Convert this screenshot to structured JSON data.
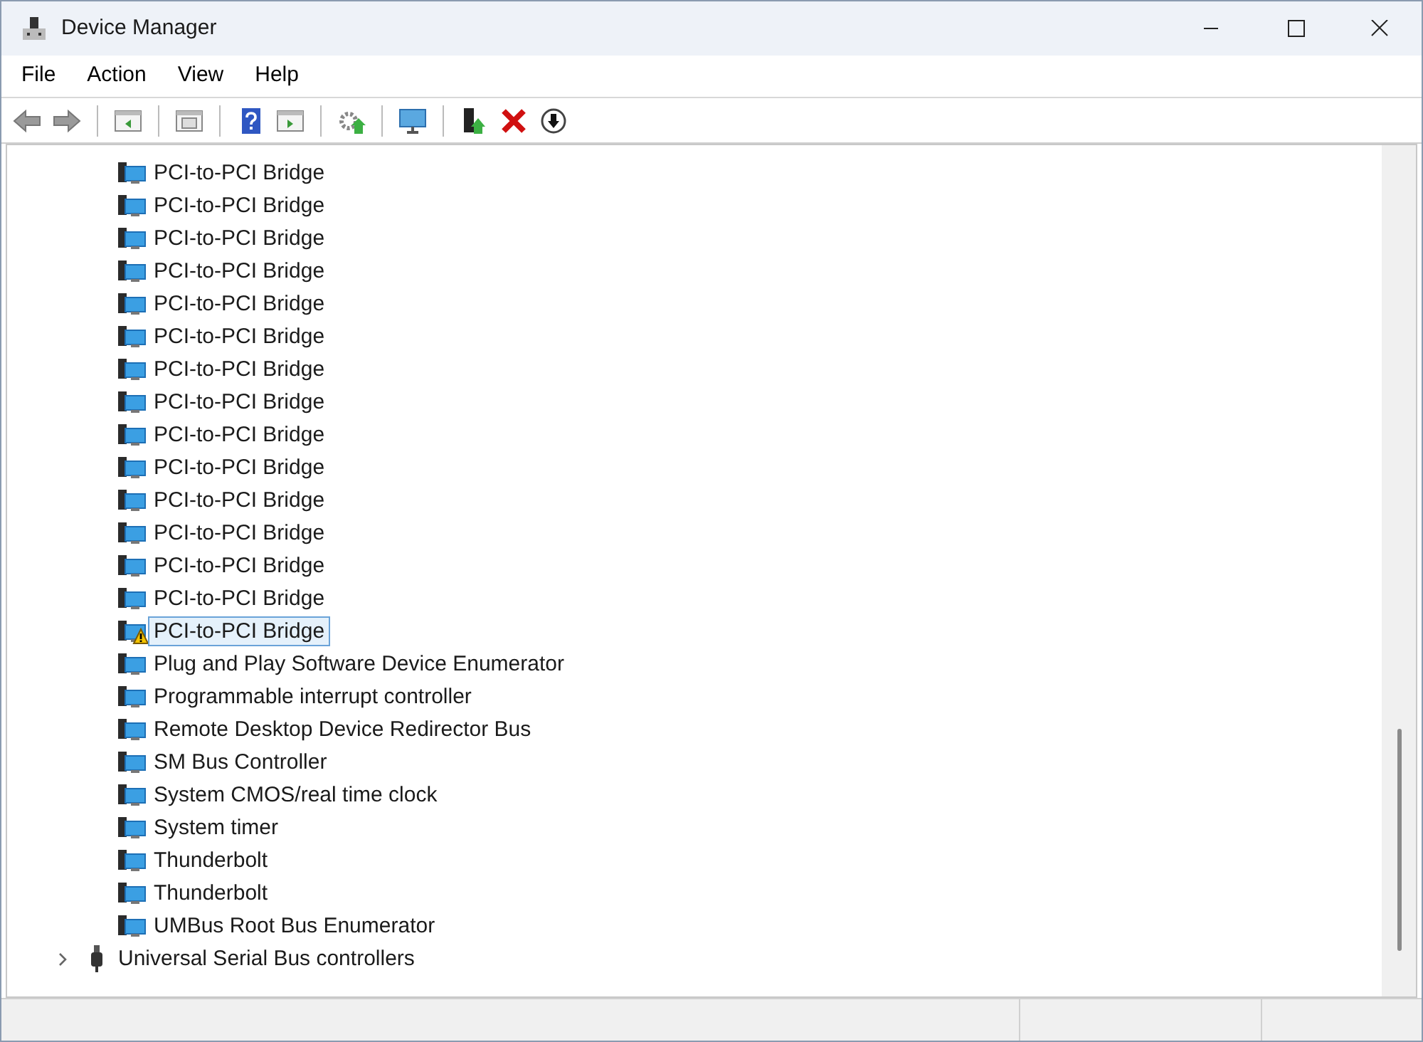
{
  "window": {
    "title": "Device Manager"
  },
  "menu": [
    "File",
    "Action",
    "View",
    "Help"
  ],
  "tree": {
    "visible_children": [
      {
        "label": "PCI-to-PCI Bridge",
        "selected": false,
        "warning": false
      },
      {
        "label": "PCI-to-PCI Bridge",
        "selected": false,
        "warning": false
      },
      {
        "label": "PCI-to-PCI Bridge",
        "selected": false,
        "warning": false
      },
      {
        "label": "PCI-to-PCI Bridge",
        "selected": false,
        "warning": false
      },
      {
        "label": "PCI-to-PCI Bridge",
        "selected": false,
        "warning": false
      },
      {
        "label": "PCI-to-PCI Bridge",
        "selected": false,
        "warning": false
      },
      {
        "label": "PCI-to-PCI Bridge",
        "selected": false,
        "warning": false
      },
      {
        "label": "PCI-to-PCI Bridge",
        "selected": false,
        "warning": false
      },
      {
        "label": "PCI-to-PCI Bridge",
        "selected": false,
        "warning": false
      },
      {
        "label": "PCI-to-PCI Bridge",
        "selected": false,
        "warning": false
      },
      {
        "label": "PCI-to-PCI Bridge",
        "selected": false,
        "warning": false
      },
      {
        "label": "PCI-to-PCI Bridge",
        "selected": false,
        "warning": false
      },
      {
        "label": "PCI-to-PCI Bridge",
        "selected": false,
        "warning": false
      },
      {
        "label": "PCI-to-PCI Bridge",
        "selected": false,
        "warning": false
      },
      {
        "label": "PCI-to-PCI Bridge",
        "selected": true,
        "warning": true
      },
      {
        "label": "Plug and Play Software Device Enumerator",
        "selected": false,
        "warning": false
      },
      {
        "label": "Programmable interrupt controller",
        "selected": false,
        "warning": false
      },
      {
        "label": "Remote Desktop Device Redirector Bus",
        "selected": false,
        "warning": false
      },
      {
        "label": "SM Bus Controller",
        "selected": false,
        "warning": false
      },
      {
        "label": "System CMOS/real time clock",
        "selected": false,
        "warning": false
      },
      {
        "label": "System timer",
        "selected": false,
        "warning": false
      },
      {
        "label": "Thunderbolt",
        "selected": false,
        "warning": false
      },
      {
        "label": "Thunderbolt",
        "selected": false,
        "warning": false
      },
      {
        "label": "UMBus Root Bus Enumerator",
        "selected": false,
        "warning": false
      }
    ],
    "categories": [
      {
        "label": "Universal Serial Bus controllers",
        "expanded": false
      }
    ]
  }
}
